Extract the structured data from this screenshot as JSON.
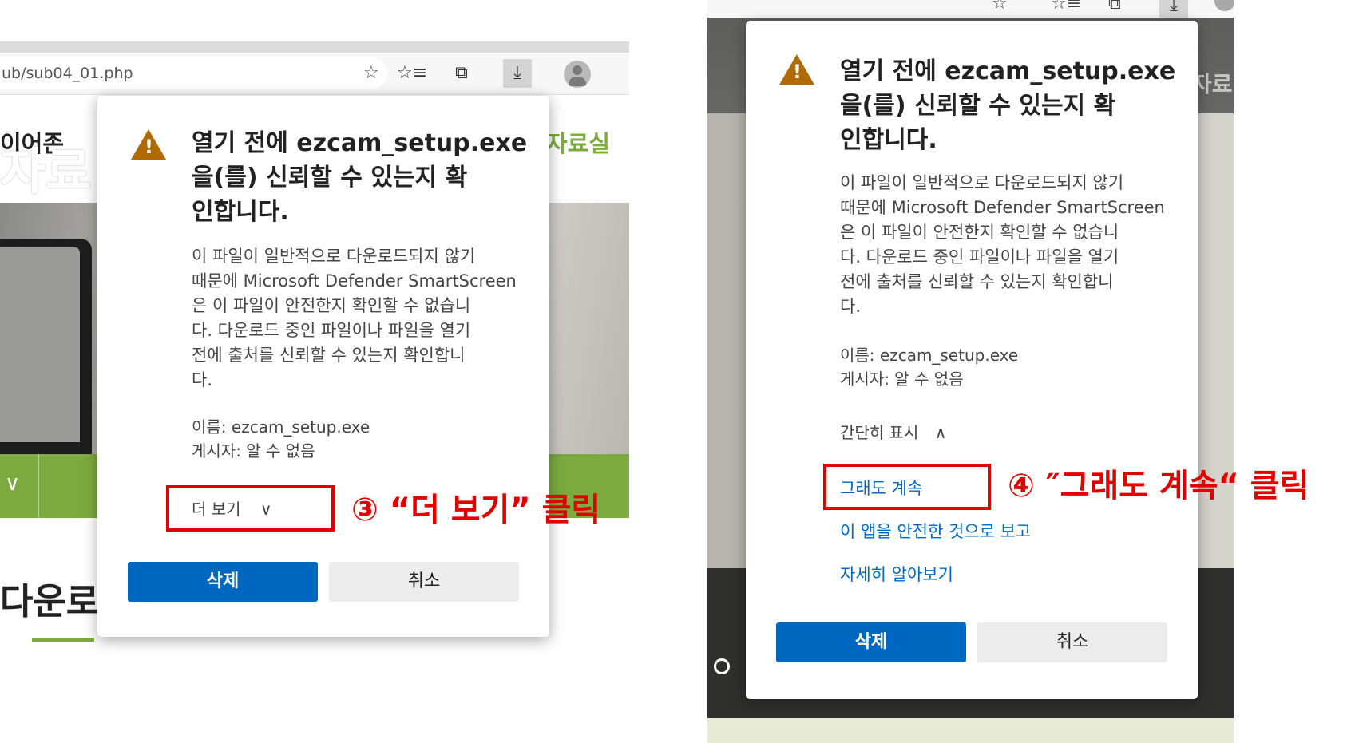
{
  "left": {
    "address_text": "ub/sub04_01.php",
    "nav_left_text": "이어존",
    "nav_right_text": "자료실",
    "hero_title": "자료",
    "section_title": "다운로",
    "dialog": {
      "heading": "열기 전에 ezcam_setup.exe\n을(를) 신뢰할 수 있는지 확\n인합니다.",
      "body": "이 파일이 일반적으로 다운로드되지 않기\n때문에 Microsoft Defender SmartScreen\n은 이 파일이 안전한지 확인할 수 없습니\n다. 다운로드 중인 파일이나 파일을 열기\n전에 출처를 신뢰할 수 있는지 확인합니\n다.",
      "name_line": "이름: ezcam_setup.exe",
      "publisher_line": "게시자: 알 수 없음",
      "more_label": "더 보기",
      "delete_label": "삭제",
      "cancel_label": "취소"
    },
    "annotation": "③ “더 보기” 클릭"
  },
  "right": {
    "nav_right_text": "자료",
    "dialog": {
      "heading": "열기 전에 ezcam_setup.exe\n을(를) 신뢰할 수 있는지 확\n인합니다.",
      "body": "이 파일이 일반적으로 다운로드되지 않기\n때문에 Microsoft Defender SmartScreen\n은 이 파일이 안전한지 확인할 수 없습니\n다. 다운로드 중인 파일이나 파일을 열기\n전에 출처를 신뢰할 수 있는지 확인합니\n다.",
      "name_line": "이름: ezcam_setup.exe",
      "publisher_line": "게시자: 알 수 없음",
      "less_label": "간단히 표시",
      "continue_label": "그래도 계속",
      "report_safe_label": "이 앱을 안전한 것으로 보고",
      "learn_more_label": "자세히 알아보기",
      "delete_label": "삭제",
      "cancel_label": "취소"
    },
    "annotation": "④ ″그래도 계속“ 클릭"
  },
  "colors": {
    "accent_blue": "#0067c0",
    "annotation_red": "#e00000",
    "site_green": "#7caa3f",
    "warning_brown": "#b06a00"
  },
  "icons": {
    "favorite_add": "star-plus-icon",
    "favorites": "favorites-list-icon",
    "collections": "collections-icon",
    "downloads": "download-warning-icon",
    "profile": "avatar-icon"
  }
}
